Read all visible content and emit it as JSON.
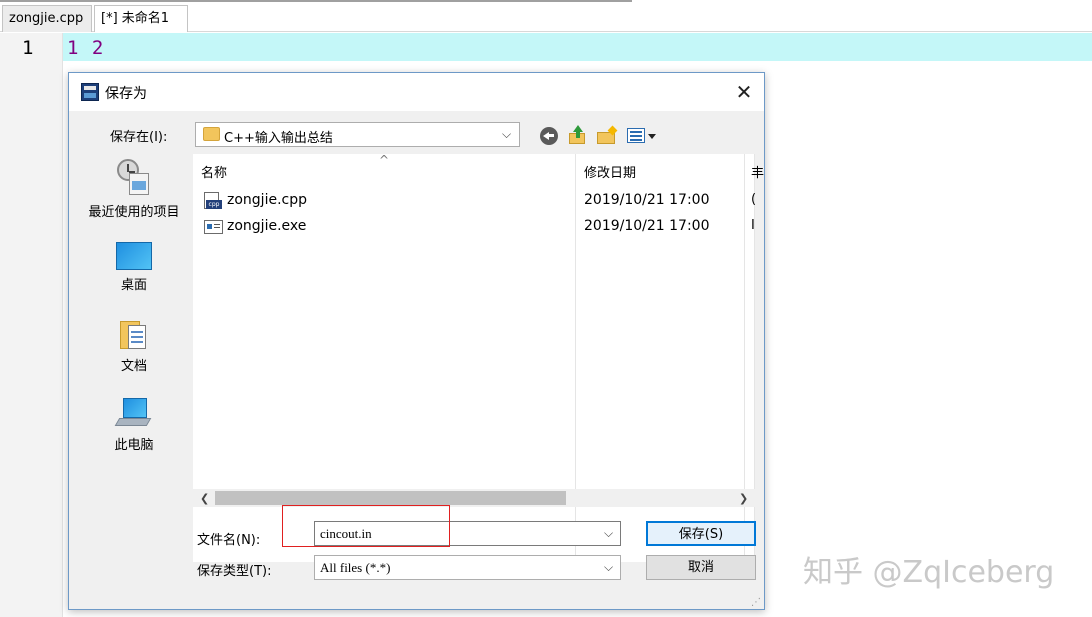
{
  "editor": {
    "tabs": [
      {
        "label": "zongjie.cpp"
      },
      {
        "label": "[*] 未命名1"
      }
    ],
    "line_number": "1",
    "code_text": "1 2"
  },
  "dialog": {
    "title": "保存为",
    "close_glyph": "✕",
    "save_in_label": "保存在(I):",
    "save_in_value": "C++输入输出总结",
    "places": [
      {
        "label": "最近使用的项目",
        "icon": "recent-items-icon"
      },
      {
        "label": "桌面",
        "icon": "desktop-icon"
      },
      {
        "label": "文档",
        "icon": "documents-icon"
      },
      {
        "label": "此电脑",
        "icon": "this-pc-icon"
      }
    ],
    "columns": {
      "name": "名称",
      "modified": "修改日期",
      "third_cut": "丰"
    },
    "files": [
      {
        "name": "zongjie.cpp",
        "modified": "2019/10/21 17:00",
        "third": "(",
        "icon": "cpp-file-icon"
      },
      {
        "name": "zongjie.exe",
        "modified": "2019/10/21 17:00",
        "third": "I",
        "icon": "exe-file-icon"
      }
    ],
    "file_name_label": "文件名(N):",
    "file_name_value": "cincout.in",
    "save_type_label": "保存类型(T):",
    "save_type_value": "All files (*.*)",
    "save_button": "保存(S)",
    "cancel_button": "取消"
  },
  "watermark": "知乎 @ZqIceberg",
  "colors": {
    "current_line": "#c4f7f8",
    "code": "#800080",
    "accent": "#0078d7",
    "highlight_box": "#e02020"
  }
}
